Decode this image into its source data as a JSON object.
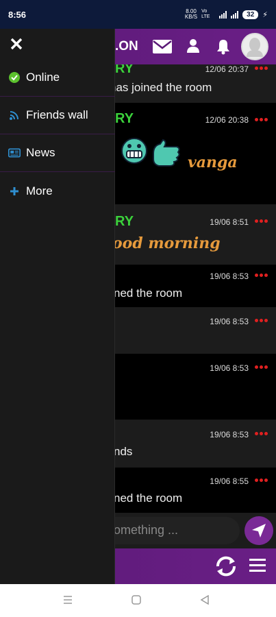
{
  "status": {
    "time": "8:56",
    "net_speed_top": "8.00",
    "net_speed_bottom": "KB/S",
    "network_type": "Vo LTE",
    "battery": "32"
  },
  "topbar": {
    "brand": ".ON",
    "icons": [
      "mail-icon",
      "user-icon",
      "bell-icon",
      "avatar"
    ]
  },
  "drawer": {
    "items": [
      {
        "label": "Online",
        "icon": "check-circle-icon",
        "color": "#5cc12e"
      },
      {
        "label": "Friends wall",
        "icon": "rss-icon",
        "color": "#2f8fd0"
      },
      {
        "label": "News",
        "icon": "newspaper-icon",
        "color": "#2f8fd0"
      },
      {
        "label": "More",
        "icon": "plus-icon",
        "color": "#2f8fd0"
      }
    ]
  },
  "messages": [
    {
      "name": "RY",
      "time": "12/06 20:37",
      "text": "has joined the room"
    },
    {
      "name": "RY",
      "time": "12/06 20:38",
      "text": "vanga"
    },
    {
      "name": "RY",
      "time": "19/06 8:51",
      "text": "ood morning"
    },
    {
      "name": "",
      "time": "19/06 8:53",
      "text": "ned the room"
    },
    {
      "name": "",
      "time": "19/06 8:53",
      "text": ""
    },
    {
      "name": "",
      "time": "19/06 8:53",
      "text": ""
    },
    {
      "name": "",
      "time": "19/06 8:53",
      "text": "nds"
    },
    {
      "name": "",
      "time": "19/06 8:55",
      "text": "ned the room"
    }
  ],
  "composer": {
    "placeholder": "omething ..."
  },
  "colors": {
    "accent": "#6a1f86",
    "username": "#3bd13b",
    "fancy_text": "#e69a3c",
    "menu_dots": "#e02020"
  }
}
